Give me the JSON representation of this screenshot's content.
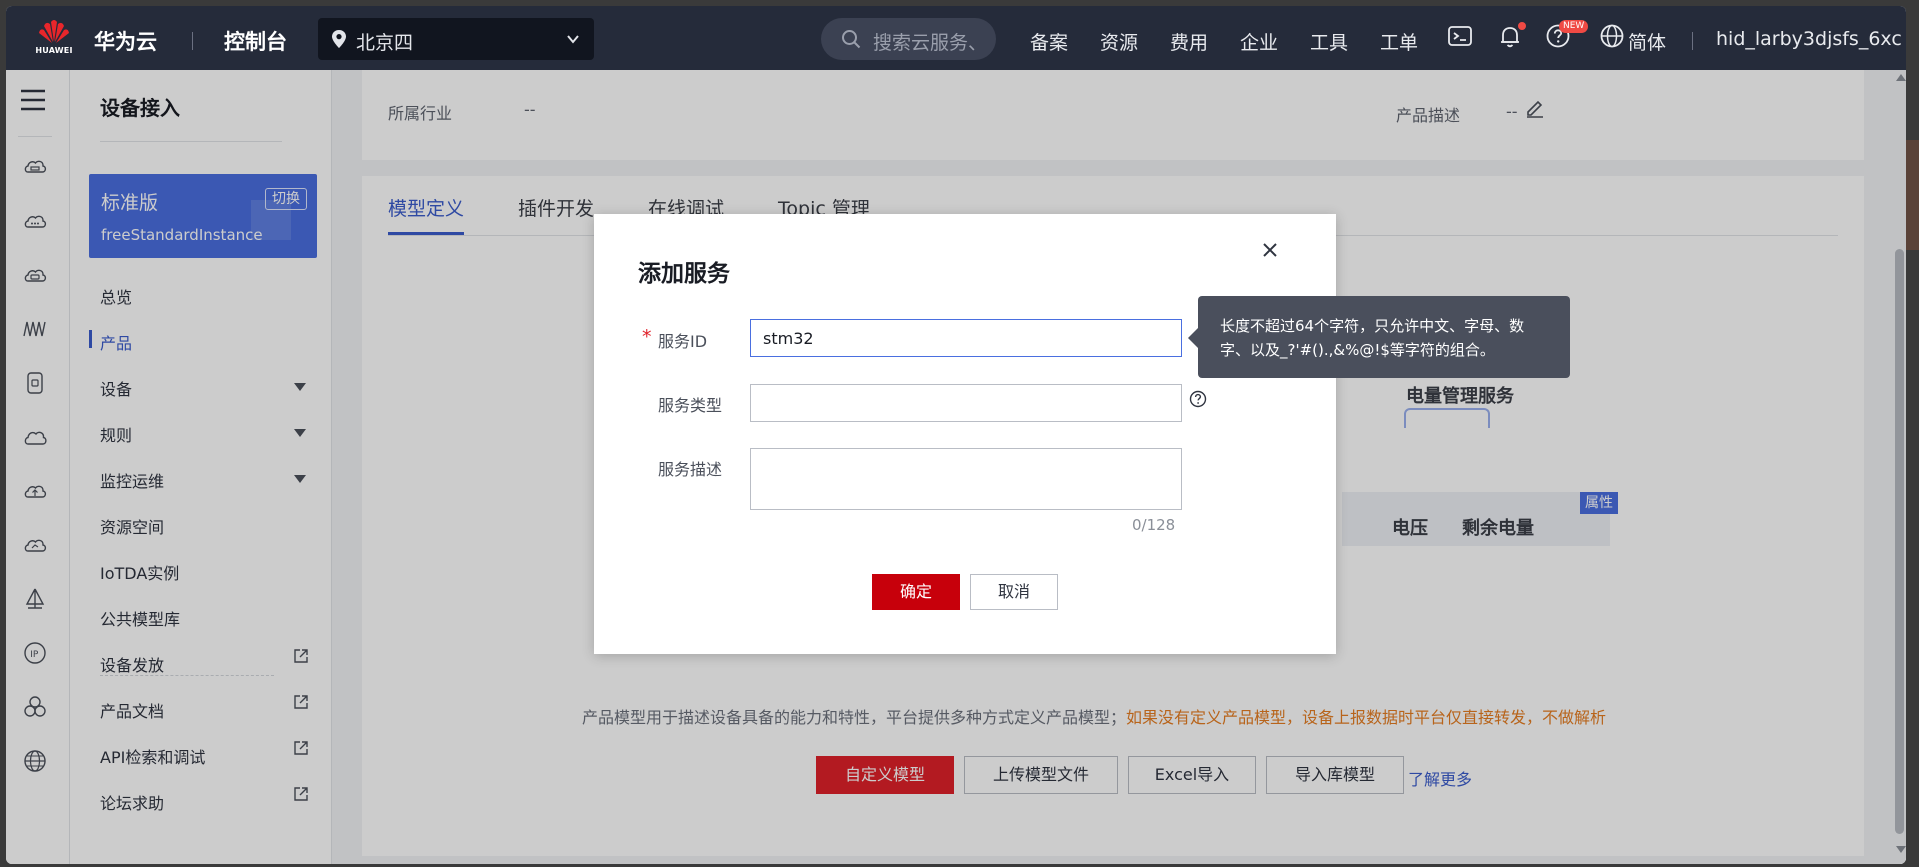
{
  "topbar": {
    "logo_text": "HUAWEI",
    "brand": "华为云",
    "console": "控制台",
    "region": "北京四",
    "search_placeholder": "搜索云服务、",
    "nav": [
      "备案",
      "资源",
      "费用",
      "企业",
      "工具",
      "工单"
    ],
    "new_badge": "NEW",
    "language": "简体",
    "user": "hid_larby3djsfs_6xc"
  },
  "sidebar": {
    "title": "设备接入",
    "edition": {
      "name": "标准版",
      "switch": "切换",
      "instance": "freeStandardInstance"
    },
    "items": [
      "总览",
      "产品",
      "设备",
      "规则",
      "监控运维",
      "资源空间",
      "IoTDA实例",
      "公共模型库",
      "设备发放",
      "产品文档",
      "API检索和调试",
      "论坛求助"
    ],
    "active_item": "产品"
  },
  "product_info": {
    "industry_label": "所属行业",
    "industry_value": "--",
    "description_label": "产品描述",
    "description_value": "--"
  },
  "tabs": [
    "模型定义",
    "插件开发",
    "在线调试",
    "Topic 管理"
  ],
  "diagram": {
    "service_name": "电量管理服务",
    "properties": [
      "电压",
      "剩余电量"
    ],
    "tag": "属性"
  },
  "model_hint": {
    "text": "产品模型用于描述设备具备的能力和特性，平台提供多种方式定义产品模型；",
    "warning": "如果没有定义产品模型，设备上报数据时平台仅直接转发，不做解析"
  },
  "model_buttons": [
    "自定义模型",
    "上传模型文件",
    "Excel导入",
    "导入库模型"
  ],
  "learn_more": "了解更多",
  "dialog": {
    "title": "添加服务",
    "required_mark": "*",
    "service_id_label": "服务ID",
    "service_id_value": "stm32",
    "service_type_label": "服务类型",
    "service_type_value": "",
    "service_desc_label": "服务描述",
    "service_desc_value": "",
    "counter": "0/128",
    "confirm": "确定",
    "cancel": "取消"
  },
  "tooltip": {
    "line1": "长度不超过64个字符，只允许中文、字母、数",
    "line2": "字、以及_?'#().,&%@!$等字符的组合。"
  },
  "colors": {
    "topbar": "#252b3a",
    "accent": "#4a6fe0",
    "primary_button": "#c7000b",
    "warning_text": "#e67e22"
  }
}
